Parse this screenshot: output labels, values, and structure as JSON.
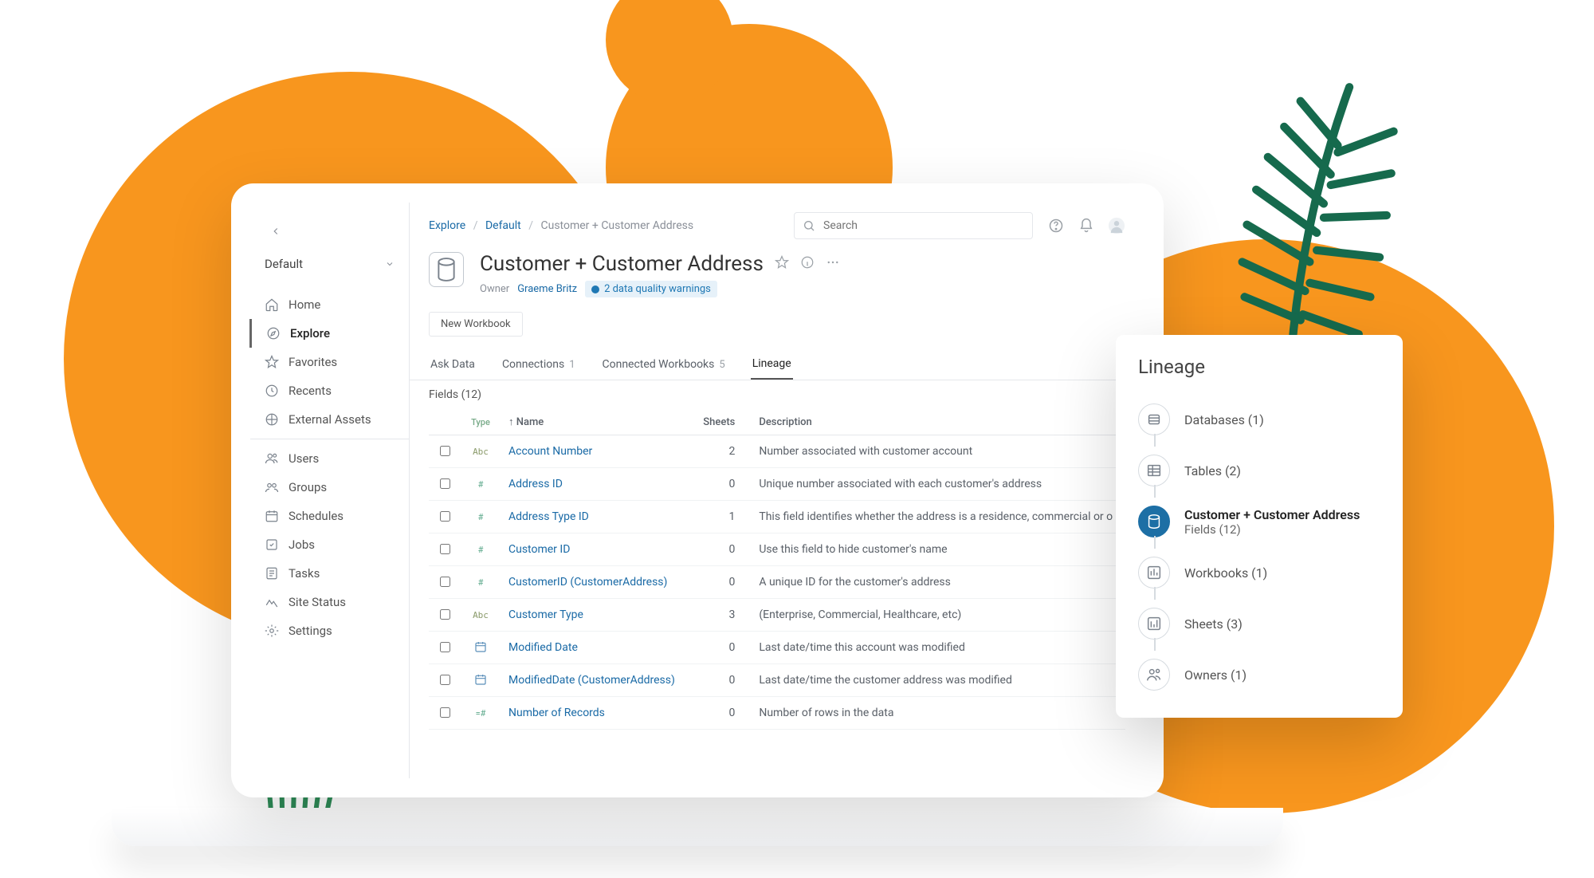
{
  "sidebar": {
    "project": "Default",
    "groups": [
      {
        "items": [
          {
            "id": "home",
            "label": "Home"
          },
          {
            "id": "explore",
            "label": "Explore",
            "active": true
          },
          {
            "id": "favorites",
            "label": "Favorites"
          },
          {
            "id": "recents",
            "label": "Recents"
          },
          {
            "id": "external",
            "label": "External Assets"
          }
        ]
      },
      {
        "items": [
          {
            "id": "users",
            "label": "Users"
          },
          {
            "id": "groups",
            "label": "Groups"
          },
          {
            "id": "schedules",
            "label": "Schedules"
          },
          {
            "id": "jobs",
            "label": "Jobs"
          },
          {
            "id": "tasks",
            "label": "Tasks"
          },
          {
            "id": "sitestatus",
            "label": "Site Status"
          },
          {
            "id": "settings",
            "label": "Settings"
          }
        ]
      }
    ]
  },
  "breadcrumb": {
    "root": "Explore",
    "project": "Default",
    "leaf": "Customer + Customer Address"
  },
  "search": {
    "placeholder": "Search"
  },
  "page": {
    "title": "Customer + Customer Address",
    "owner_label": "Owner",
    "owner": "Graeme Britz",
    "warning": "2 data quality warnings",
    "new_workbook": "New Workbook"
  },
  "tabs": [
    {
      "label": "Ask Data"
    },
    {
      "label": "Connections",
      "count": "1"
    },
    {
      "label": "Connected Workbooks",
      "count": "5"
    },
    {
      "label": "Lineage",
      "active": true
    }
  ],
  "fields": {
    "heading": "Fields (12)",
    "cols": {
      "type": "Type",
      "name": "Name",
      "sheets": "Sheets",
      "desc": "Description"
    },
    "rows": [
      {
        "type": "Abc",
        "name": "Account Number",
        "sheets": "2",
        "desc": "Number associated with customer account"
      },
      {
        "type": "#",
        "name": "Address ID",
        "sheets": "0",
        "desc": "Unique number associated with each customer's address"
      },
      {
        "type": "#",
        "name": "Address Type ID",
        "sheets": "1",
        "desc": "This field identifies whether the address is a residence, commercial or o"
      },
      {
        "type": "#",
        "name": "Customer ID",
        "sheets": "0",
        "desc": "Use this field to hide customer's name"
      },
      {
        "type": "#",
        "name": "CustomerID (CustomerAddress)",
        "sheets": "0",
        "desc": "A unique ID for the customer's address"
      },
      {
        "type": "Abc",
        "name": "Customer Type",
        "sheets": "3",
        "desc": "(Enterprise, Commercial, Healthcare, etc)"
      },
      {
        "type": "date",
        "name": "Modified Date",
        "sheets": "0",
        "desc": "Last date/time this account was modified"
      },
      {
        "type": "date",
        "name": "ModifiedDate (CustomerAddress)",
        "sheets": "0",
        "desc": "Last date/time the customer address was modified"
      },
      {
        "type": "=#",
        "name": "Number of Records",
        "sheets": "0",
        "desc": "Number of rows in the data"
      }
    ]
  },
  "lineage": {
    "title": "Lineage",
    "nodes": [
      {
        "icon": "db",
        "label": "Databases (1)"
      },
      {
        "icon": "table",
        "label": "Tables (2)"
      },
      {
        "icon": "ds",
        "label": "Customer + Customer Address",
        "sub": "Fields (12)",
        "active": true
      },
      {
        "icon": "wb",
        "label": "Workbooks (1)"
      },
      {
        "icon": "sheet",
        "label": "Sheets (3)"
      },
      {
        "icon": "owner",
        "label": "Owners (1)"
      }
    ]
  }
}
